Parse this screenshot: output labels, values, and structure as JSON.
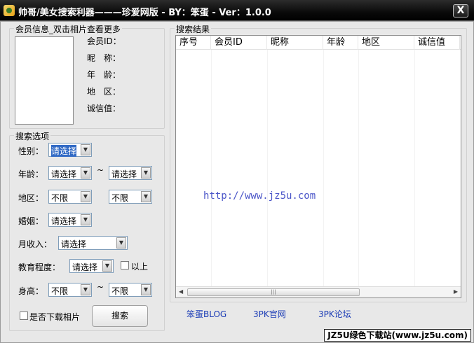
{
  "window": {
    "title": "帅哥/美女搜索利器———珍爱网版 - BY：笨蛋 - Ver：1.0.0",
    "close_label": "X"
  },
  "member_info": {
    "group_title": "会员信息_双击相片查看更多",
    "labels": [
      "会员ID：",
      "昵　称：",
      "年　龄：",
      "地　区：",
      "诚信值："
    ]
  },
  "search_options": {
    "group_title": "搜索选项",
    "gender": {
      "label": "性别：",
      "value": "请选择"
    },
    "age": {
      "label": "年龄：",
      "from": "请选择",
      "sep": "~",
      "to": "请选择"
    },
    "region": {
      "label": "地区：",
      "province": "不限",
      "city": "不限"
    },
    "marriage": {
      "label": "婚姻：",
      "value": "请选择"
    },
    "income": {
      "label": "月收入：",
      "value": "请选择"
    },
    "education": {
      "label": "教育程度：",
      "value": "请选择",
      "above_label": "以上"
    },
    "height": {
      "label": "身高：",
      "from": "不限",
      "sep": "~",
      "to": "不限"
    },
    "download_photo_label": "是否下载相片",
    "search_button": "搜索"
  },
  "results": {
    "group_title": "搜索结果",
    "columns": [
      "序号",
      "会员ID",
      "昵称",
      "年龄",
      "地区",
      "诚信值"
    ],
    "watermark": "http://www.jz5u.com"
  },
  "links": [
    "笨蛋BLOG",
    "3PK官网",
    "3PK论坛"
  ],
  "badge": "JZ5U绿色下载站(www.jz5u.com)"
}
